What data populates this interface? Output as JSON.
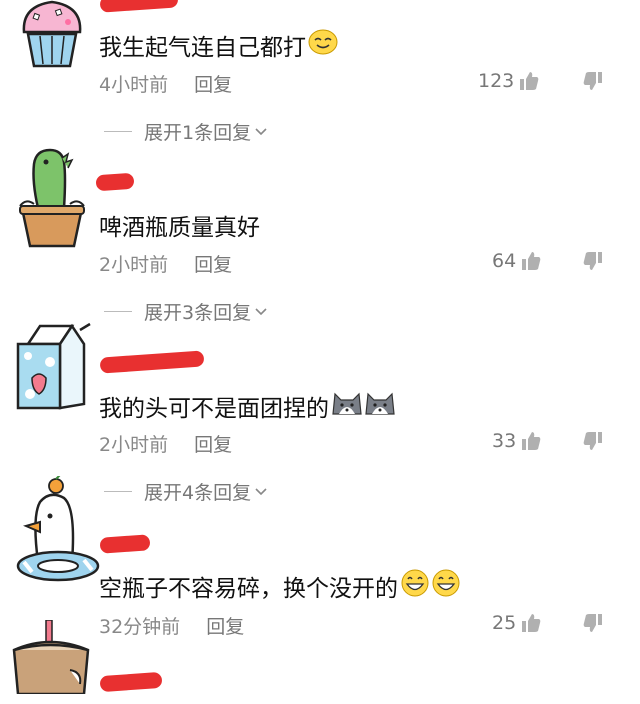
{
  "comments": [
    {
      "text": "我生起气连自己都打",
      "time": "4小时前",
      "reply": "回复",
      "likes": "123",
      "replies": "展开1条回复",
      "name_fragment": "",
      "emoji": "smiling-face-icon"
    },
    {
      "text": "啤酒瓶质量真好",
      "time": "2小时前",
      "reply": "回复",
      "likes": "64",
      "replies": "展开3条回复",
      "name_fragment": "",
      "emoji": ""
    },
    {
      "text": "我的头可不是面团捏的",
      "time": "2小时前",
      "reply": "回复",
      "likes": "33",
      "replies": "展开4条回复",
      "name_fragment": "",
      "emoji": "husky-face-icon"
    },
    {
      "text": "空瓶子不容易碎，换个没开的",
      "time": "32分钟前",
      "reply": "回复",
      "likes": "25",
      "replies": "",
      "name_fragment": "",
      "emoji": "grinning-face-icon"
    },
    {
      "text": "",
      "time": "",
      "reply": "",
      "likes": "",
      "replies": "",
      "name_fragment": "",
      "emoji": ""
    }
  ],
  "colors": {
    "redaction": "#e83030",
    "meta": "#888888",
    "text": "#111111"
  }
}
